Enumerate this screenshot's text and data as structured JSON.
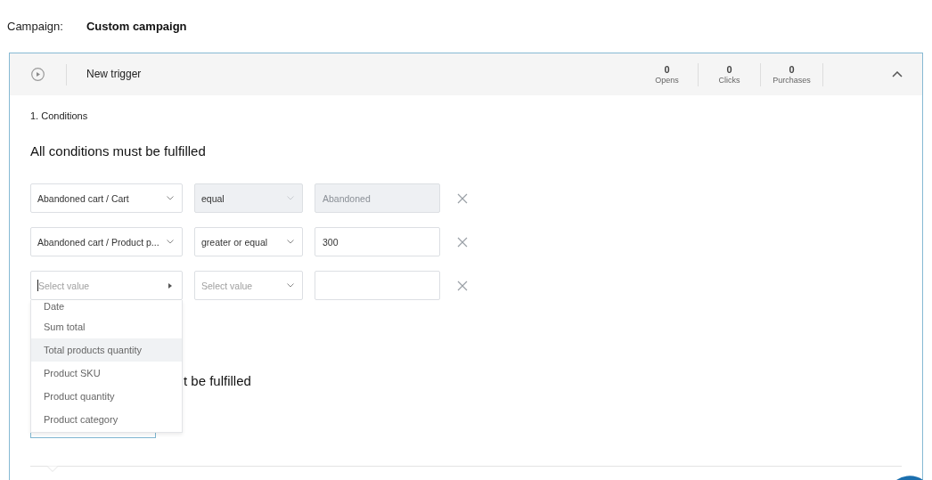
{
  "campaign": {
    "label": "Campaign:",
    "name": "Custom campaign"
  },
  "trigger": {
    "title": "New trigger",
    "expanded": true,
    "stats": [
      {
        "value": "0",
        "label": "Opens"
      },
      {
        "value": "0",
        "label": "Clicks"
      },
      {
        "value": "0",
        "label": "Purchases"
      }
    ]
  },
  "section_title": "1. Conditions",
  "groups": [
    {
      "heading": "All conditions must be fulfilled",
      "rows": [
        {
          "attribute": {
            "value": "Abandoned cart / Cart",
            "disabled": false,
            "expanded": false,
            "focused": false
          },
          "operator": {
            "value": "equal",
            "disabled": true
          },
          "input": {
            "value": "Abandoned",
            "disabled": true
          }
        },
        {
          "attribute": {
            "value": "Abandoned cart / Product p...",
            "disabled": false,
            "expanded": false,
            "focused": false
          },
          "operator": {
            "value": "greater or equal",
            "disabled": false
          },
          "input": {
            "value": "300",
            "disabled": false
          }
        },
        {
          "attribute": {
            "placeholder": "Select value",
            "disabled": false,
            "expanded": true,
            "focused": true,
            "options": [
              {
                "label": "Date",
                "selected": false
              },
              {
                "label": "Sum total",
                "selected": false
              },
              {
                "label": "Total products quantity",
                "selected": true
              },
              {
                "label": "Product SKU",
                "selected": false
              },
              {
                "label": "Product quantity",
                "selected": false
              },
              {
                "label": "Product category",
                "selected": false
              }
            ]
          },
          "operator": {
            "placeholder": "Select value",
            "disabled": false
          },
          "input": {
            "disabled": false
          }
        }
      ]
    },
    {
      "heading": "t be fulfilled"
    }
  ]
}
